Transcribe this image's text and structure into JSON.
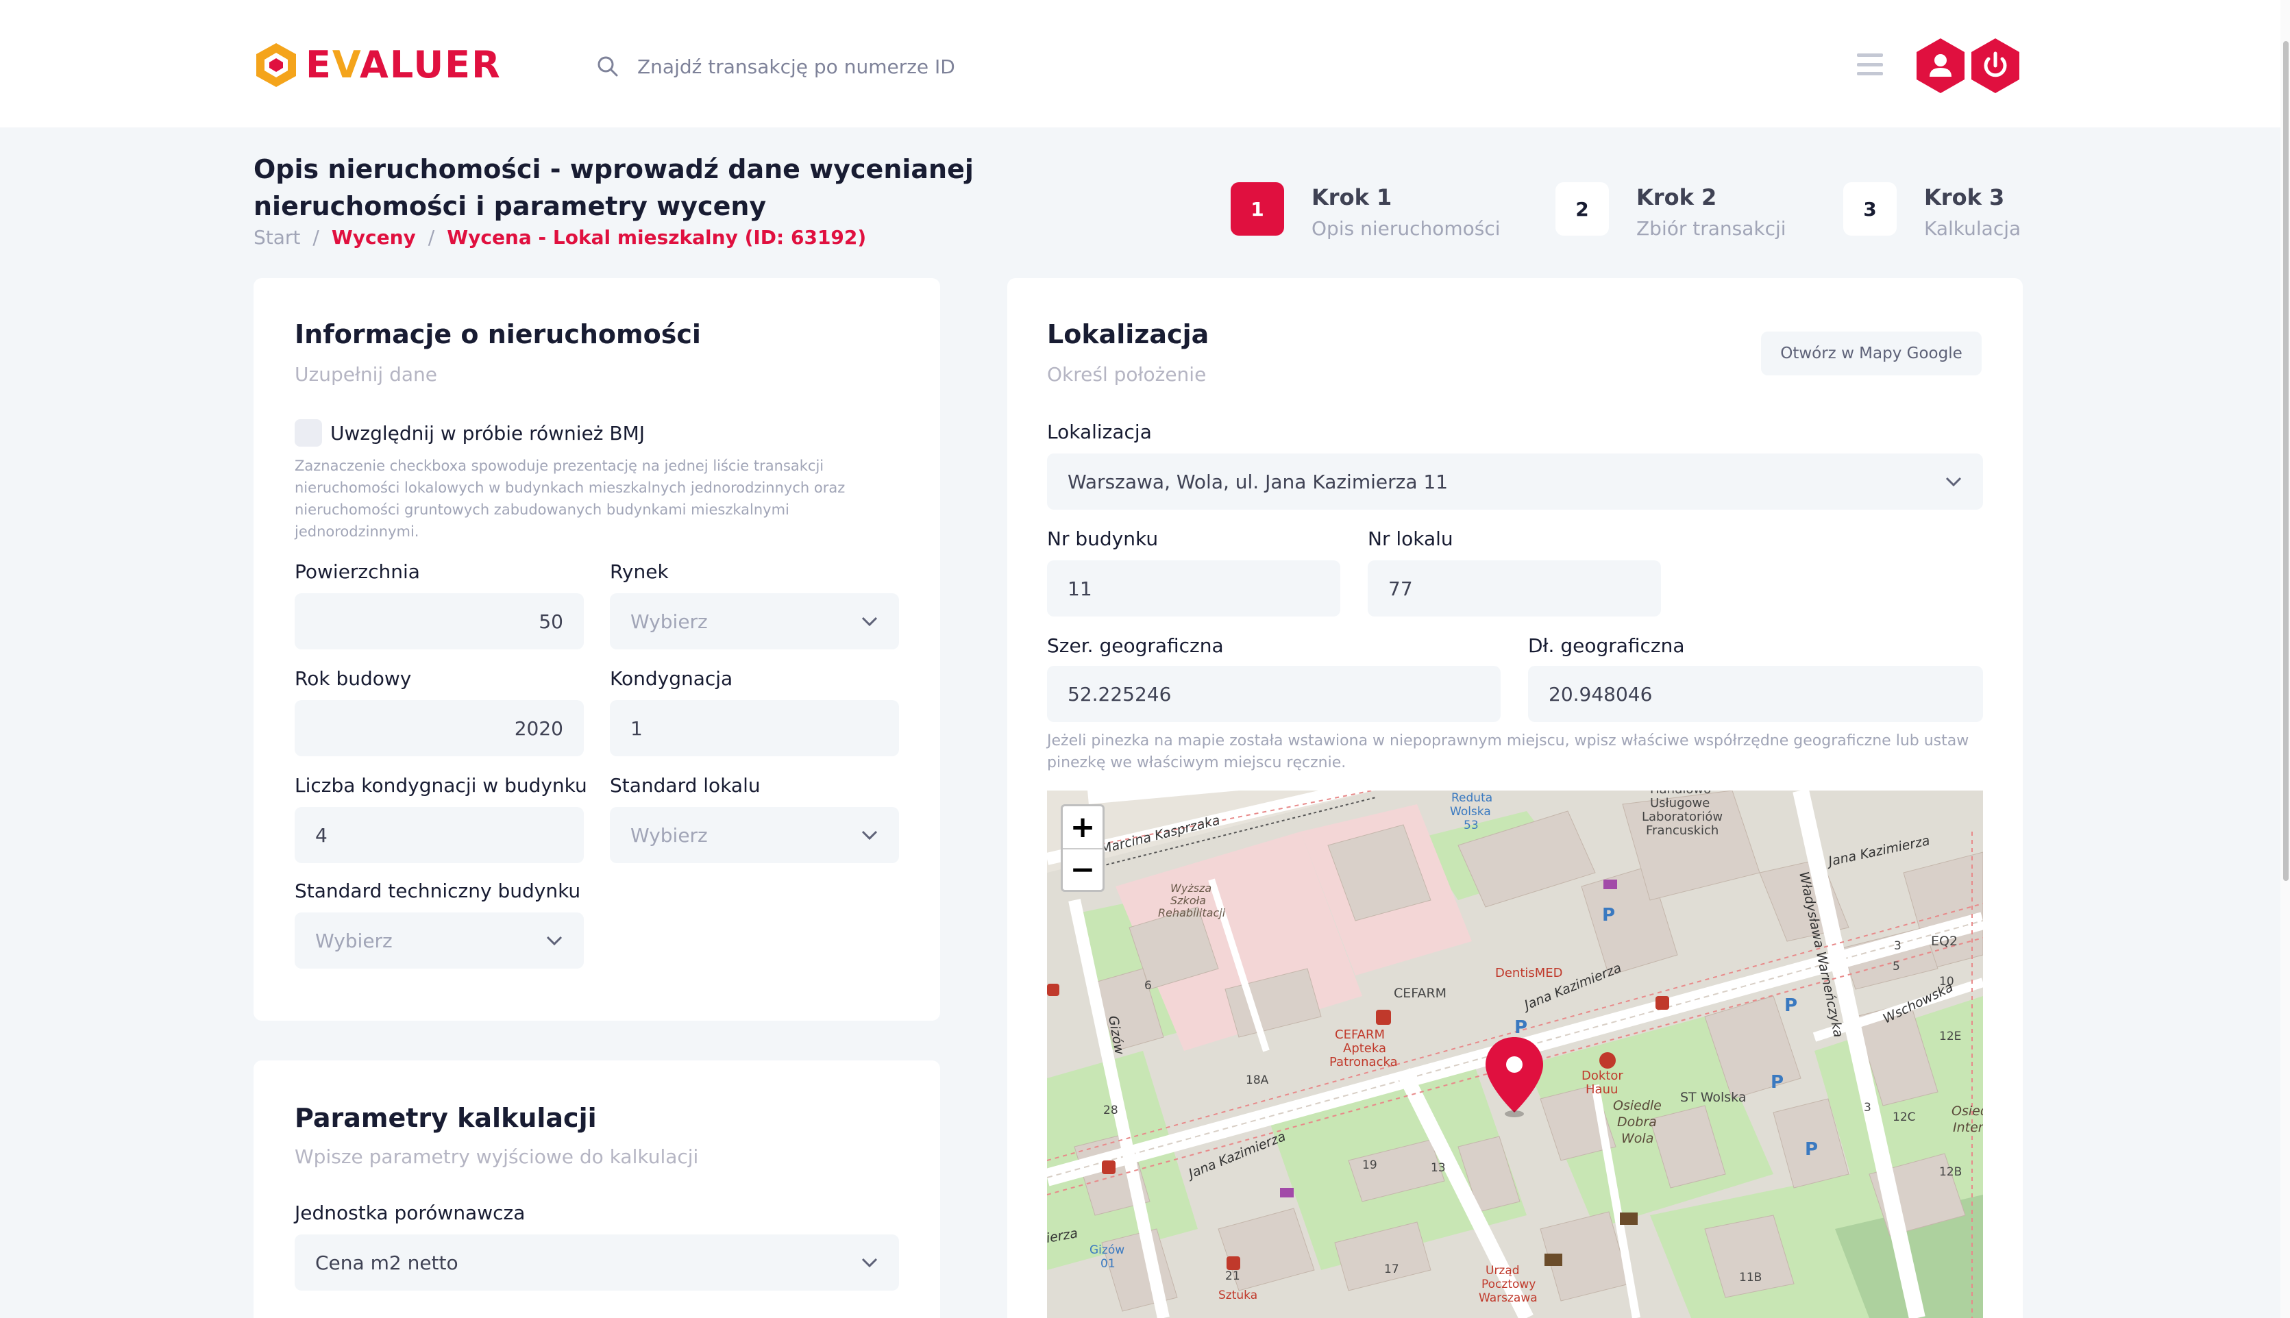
{
  "header": {
    "logo_text": "EVALUER",
    "search_placeholder": "Znajdź transakcję po numerze ID"
  },
  "page": {
    "title": "Opis nieruchomości - wprowadź dane wycenianej nieruchomości i parametry wyceny",
    "breadcrumb": [
      "Start",
      "Wyceny",
      "Wycena - Lokal mieszkalny (ID: 63192)"
    ]
  },
  "steps": [
    {
      "number": "1",
      "title": "Krok 1",
      "subtitle": "Opis nieruchomości"
    },
    {
      "number": "2",
      "title": "Krok 2",
      "subtitle": "Zbiór transakcji"
    },
    {
      "number": "3",
      "title": "Krok 3",
      "subtitle": "Kalkulacja"
    }
  ],
  "property_info": {
    "title": "Informacje o nieruchomości",
    "subtitle": "Uzupełnij dane",
    "bmj_label": "Uwzględnij w próbie również BMJ",
    "bmj_hint": "Zaznaczenie checkboxa spowoduje prezentację na jednej liście transakcji nieruchomości lokalowych w budynkach mieszkalnych jednorodzinnych oraz nieruchomości gruntowych zabudowanych budynkami mieszkalnymi jednorodzinnymi.",
    "area_label": "Powierzchnia",
    "area_value": "50",
    "market_label": "Rynek",
    "market_value": "Wybierz",
    "year_label": "Rok budowy",
    "year_value": "2020",
    "floor_label": "Kondygnacja",
    "floor_value": "1",
    "floors_count_label": "Liczba kondygnacji w budynku",
    "floors_count_value": "4",
    "standard_label": "Standard lokalu",
    "standard_value": "Wybierz",
    "tech_standard_label": "Standard techniczny budynku",
    "tech_standard_value": "Wybierz"
  },
  "calc_params": {
    "title": "Parametry kalkulacji",
    "subtitle": "Wpisze parametry wyjściowe do kalkulacji",
    "unit_label": "Jednostka porównawcza",
    "unit_value": "Cena m2 netto"
  },
  "location": {
    "title": "Lokalizacja",
    "subtitle": "Określ położenie",
    "google_button": "Otwórz w Mapy Google",
    "location_label": "Lokalizacja",
    "location_value": "Warszawa, Wola, ul. Jana Kazimierza 11",
    "building_label": "Nr budynku",
    "building_value": "11",
    "unit_label": "Nr lokalu",
    "unit_value": "77",
    "lat_label": "Szer. geograficzna",
    "lat_value": "52.225246",
    "lng_label": "Dł. geograficzna",
    "lng_value": "20.948046",
    "hint": "Jeżeli pinezka na mapie została wstawiona w niepoprawnym miejscu, wpisz właściwe współrzędne geograficzne lub ustaw pinezkę we właściwym miejscu ręcznie."
  },
  "map": {
    "zoom_in": "+",
    "zoom_out": "−",
    "labels": [
      "Marcina Kasprzaka",
      "Reduta Wolska 53",
      "Handlowo Usługowe Laboratorium Francuskich",
      "Jana Kazimierza",
      "Wyższa Szkoła Rehabilitacji",
      "Władysława Warneńczyka",
      "EQ2",
      "DentisMED",
      "CEFARM",
      "Jana Kazimierza",
      "Wschowska",
      "Gizów",
      "CEFARM Apteka Patronacka",
      "Doktor Hauu",
      "ST Wolska",
      "Osiedle Dobra Wola",
      "Osiedl Intens",
      "Jana Kazimierza",
      "Gizów 01",
      "Urząd Pocztowy Warszawa",
      "Sztuka",
      "6",
      "5",
      "3",
      "10",
      "12E",
      "12C",
      "12B",
      "18A",
      "19",
      "13",
      "28",
      "21",
      "17",
      "11B",
      "3"
    ],
    "colors": {
      "primary": "#e0103f",
      "accent": "#f4a41b",
      "park": "#c8e6b4",
      "building": "#d9d0c9",
      "road": "#ffffff"
    }
  }
}
